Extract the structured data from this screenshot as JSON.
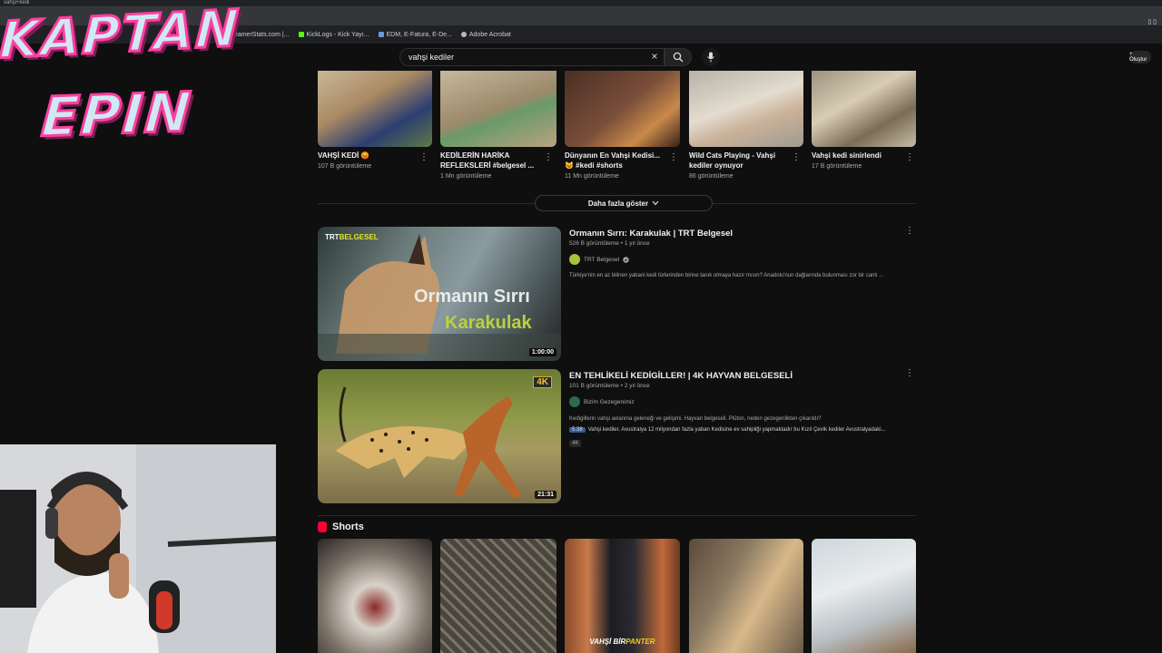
{
  "browser": {
    "tab_url_fragment": "vahşi+kedi",
    "bookmarks": [
      "StreamerStats.com |...",
      "KickLogs - Kick Yayı...",
      "EDM, E-Fatura, E-De...",
      "Adobe Acrobat"
    ],
    "right_controls": "▯ ▯"
  },
  "search": {
    "query": "vahşi kediler",
    "clear_icon": "×",
    "search_icon": "search-icon",
    "mic_icon": "microphone-icon"
  },
  "header": {
    "create_label": "+ Oluştur"
  },
  "logo": {
    "line1": "KAPTAN",
    "line2": "EPIN"
  },
  "top_shorts": [
    {
      "title_line1": "VAHŞİ KEDİ 😡",
      "title_line2": "",
      "views": "107 B görüntüleme"
    },
    {
      "title_line1": "KEDİLERİN HARİKA",
      "title_line2": "REFLEKSLERİ #belgesel ...",
      "views": "1 Mn görüntüleme"
    },
    {
      "title_line1": "Dünyanın En Vahşi Kedisi...",
      "title_line2": "😺 #kedi #shorts",
      "views": "11 Mn görüntüleme"
    },
    {
      "title_line1": "Wild Cats Playing - Vahşi",
      "title_line2": "kediler oynuyor",
      "views": "86 görüntüleme"
    },
    {
      "title_line1": "Vahşi kedi sinirlendi",
      "title_line2": "",
      "views": "17 B görüntüleme"
    }
  ],
  "more_button": "Daha fazla göster",
  "videos": [
    {
      "title": "Ormanın Sırrı: Karakulak | TRT Belgesel",
      "meta": "526 B görüntüleme • 1 yıl önce",
      "channel": "TRT Belgesel",
      "description": "Türkiye'nin en az bilinen yabani kedi türlerinden birine tanık olmaya hazır mısın? Anadolu'nun dağlarında bulunması zor bir canlı ...",
      "duration": "1:00:00",
      "thumb_brand_a": "TRT",
      "thumb_brand_b": "BELGESEL",
      "thumb_title_1": "Ormanın Sırrı",
      "thumb_title_2": "Karakulak"
    },
    {
      "title": "EN TEHLİKELİ KEDİGİLLER! | 4K HAYVAN BELGESELİ",
      "meta": "101 B görüntüleme • 2 yıl önce",
      "channel": "Bizim Gezegenimiz",
      "description": "Kedigillerin vahşi avlanma geleneği ve gelişimi. Hayvan belgeseli. Plüton, neden gezegenlikten çıkarıldı?",
      "chapter_time": "5:38",
      "chapter_text": "Vahşi kediler. Avustralya 12 milyondan fazla yaban Kedisine ev sahipliği yapmaktadır bu Kızıl Çevik kediler Avustralyadaki...",
      "quality_tag": "4K",
      "thumb_badge": "4K",
      "duration": "21:31"
    }
  ],
  "shorts_section": {
    "title": "Shorts",
    "last_caption_a": "VAHŞİ BİR",
    "last_caption_b": "PANTER"
  },
  "colors": {
    "background": "#0f0f0f",
    "text_primary": "#f1f1f1",
    "text_secondary": "#aaaaaa",
    "logo_stroke": "#ff3fa0",
    "shorts_red": "#ff0033"
  }
}
